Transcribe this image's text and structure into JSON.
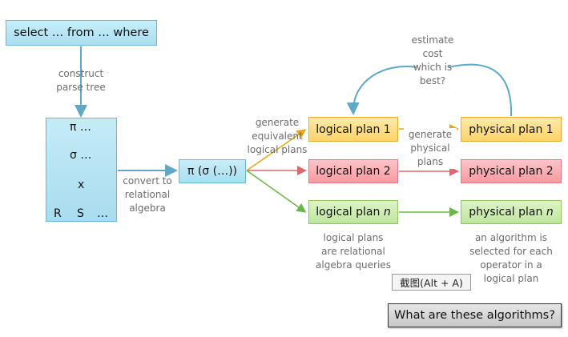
{
  "sql_box": "select … from … where",
  "construct_label": [
    "construct",
    "parse tree"
  ],
  "tree": {
    "pi": "π …",
    "sigma": "σ …",
    "times": "x",
    "leaf_r": "R",
    "leaf_s": "S",
    "leaf_more": "…"
  },
  "convert_label": [
    "convert to",
    "relational",
    "algebra"
  ],
  "pi_box": "π (σ (…))",
  "generate_equivalent_label": [
    "generate",
    "equivalent",
    "logical plans"
  ],
  "logical_plans": [
    {
      "prefix": "logical plan ",
      "suffix": "1"
    },
    {
      "prefix": "logical plan ",
      "suffix": "2"
    },
    {
      "prefix": "logical plan ",
      "suffix": "n"
    }
  ],
  "generate_physical_label": [
    "generate",
    "physical",
    "plans"
  ],
  "physical_plans": [
    {
      "prefix": "physical plan ",
      "suffix": "1"
    },
    {
      "prefix": "physical plan ",
      "suffix": "2"
    },
    {
      "prefix": "physical plan ",
      "suffix": "n"
    }
  ],
  "estimate_label": [
    "estimate",
    "cost",
    "which is",
    "best?"
  ],
  "logical_note": [
    "logical plans",
    "are relational",
    "algebra queries"
  ],
  "physical_note": [
    "an algorithm is",
    "selected for each",
    "operator in a",
    "logical plan"
  ],
  "screenshot_tag": "截图(Alt + A)",
  "question_box": "What are these algorithms?",
  "colors": {
    "blue_fill": "#b5e3f3",
    "yellow_fill": "#fbd36a",
    "red_fill": "#f59aa0",
    "green_fill": "#bfe6a0",
    "arrow_blue": "#5fa8c6",
    "arrow_yellow": "#e4a91f",
    "arrow_red": "#e06670",
    "arrow_green": "#6bb54a"
  }
}
